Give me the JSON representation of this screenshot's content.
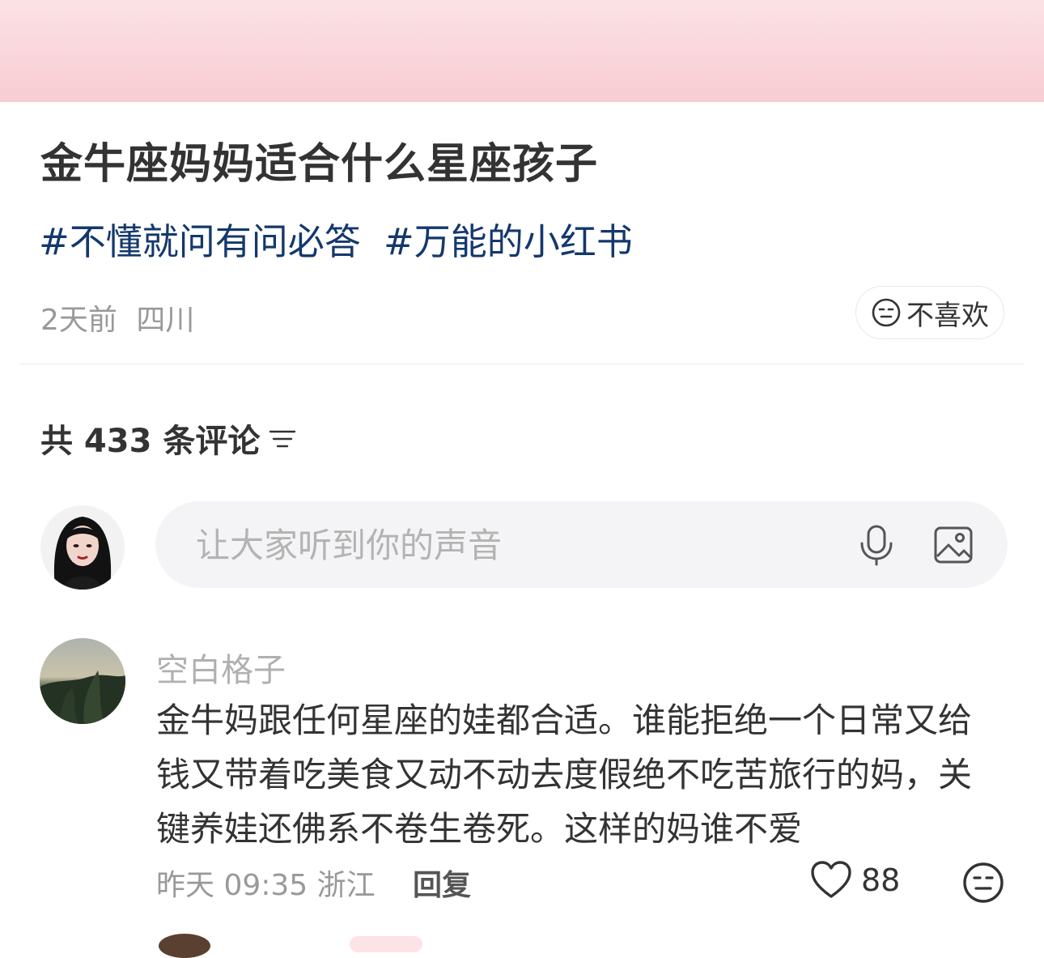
{
  "note": {
    "title": "金牛座妈妈适合什么星座孩子",
    "tags": [
      "#不懂就问有问必答",
      "#万能的小红书"
    ],
    "time": "2天前",
    "location": "四川",
    "dislike_label": "不喜欢"
  },
  "comments_header": {
    "count_label": "共 433 条评论"
  },
  "comment_input": {
    "placeholder": "让大家听到你的声音"
  },
  "comments": [
    {
      "username": "空白格子",
      "text": "金牛妈跟任何星座的娃都合适。谁能拒绝一个日常又给钱又带着吃美食又动不动去度假绝不吃苦旅行的妈，关键养娃还佛系不卷生卷死。这样的妈谁不爱",
      "time": "昨天 09:35",
      "location": "浙江",
      "reply_label": "回复",
      "likes": "88"
    }
  ],
  "colors": {
    "tag": "#13386c",
    "banner_top": "#fbe2e5",
    "banner_bottom": "#f8ccd3",
    "input_bg": "#f4f4f6"
  }
}
